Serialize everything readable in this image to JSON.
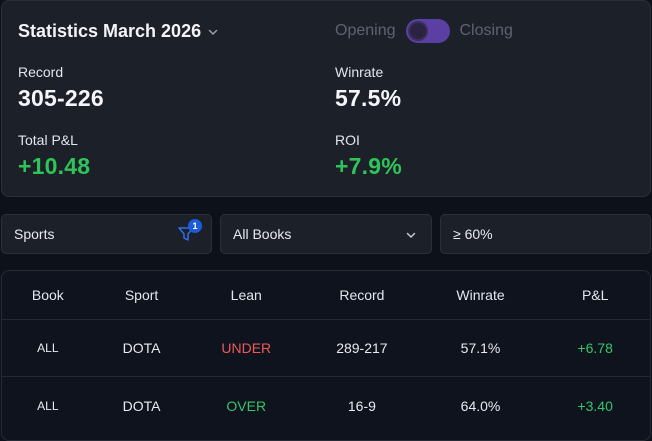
{
  "stats": {
    "title": "Statistics March 2026",
    "toggle": {
      "left_label": "Opening",
      "right_label": "Closing",
      "selected": "Opening"
    },
    "record": {
      "label": "Record",
      "value": "305-226"
    },
    "winrate": {
      "label": "Winrate",
      "value": "57.5%"
    },
    "pnl": {
      "label": "Total P&L",
      "value": "+10.48"
    },
    "roi": {
      "label": "ROI",
      "value": "+7.9%"
    }
  },
  "filters": {
    "sports": {
      "value": "Sports",
      "badge": "1",
      "icon": "filter-icon"
    },
    "books": {
      "value": "All Books",
      "icon": "chevron-down-icon"
    },
    "threshold": {
      "value": "≥ 60%"
    }
  },
  "table": {
    "headers": [
      "Book",
      "Sport",
      "Lean",
      "Record",
      "Winrate",
      "P&L"
    ],
    "rows": [
      {
        "book": "ALL",
        "sport": "DOTA",
        "lean": "UNDER",
        "record": "289-217",
        "winrate": "57.1%",
        "pnl": "+6.78"
      },
      {
        "book": "ALL",
        "sport": "DOTA",
        "lean": "OVER",
        "record": "16-9",
        "winrate": "64.0%",
        "pnl": "+3.40"
      }
    ]
  },
  "colors": {
    "positive": "#35c46a",
    "negative": "#ec5a5a",
    "accent": "#5b3fa3",
    "badge": "#1e5bd8"
  }
}
